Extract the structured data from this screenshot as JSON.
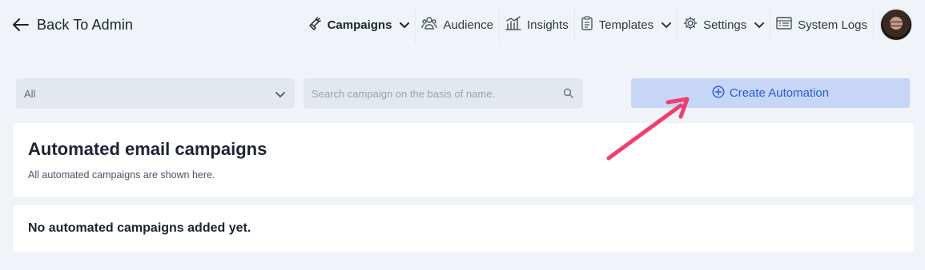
{
  "header": {
    "back_label": "Back To Admin",
    "nav": [
      {
        "label": "Campaigns",
        "icon": "megaphone-icon",
        "active": true,
        "dropdown": true
      },
      {
        "label": "Audience",
        "icon": "users-icon",
        "active": false,
        "dropdown": false
      },
      {
        "label": "Insights",
        "icon": "bar-chart-icon",
        "active": false,
        "dropdown": false
      },
      {
        "label": "Templates",
        "icon": "clipboard-icon",
        "active": false,
        "dropdown": true
      },
      {
        "label": "Settings",
        "icon": "gear-icon",
        "active": false,
        "dropdown": true
      },
      {
        "label": "System Logs",
        "icon": "list-icon",
        "active": false,
        "dropdown": false
      }
    ]
  },
  "toolbar": {
    "filter_value": "All",
    "search_placeholder": "Search campaign on the basis of name.",
    "create_label": "Create Automation"
  },
  "main": {
    "title": "Automated email campaigns",
    "subtitle": "All automated campaigns are shown here.",
    "empty_message": "No automated campaigns added yet."
  },
  "colors": {
    "page_bg": "#f0f4f8",
    "button_bg": "#c7d6f6",
    "button_text": "#2a5bd7",
    "annotation_arrow": "#ef3f6b"
  }
}
